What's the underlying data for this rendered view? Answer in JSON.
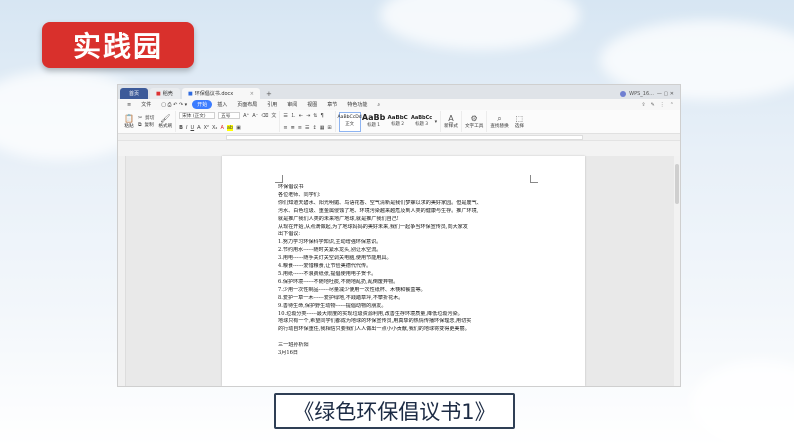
{
  "banner": {
    "title": "实践园"
  },
  "caption": "《绿色环保倡议书1》",
  "window": {
    "tabs": [
      {
        "label": "首页",
        "kind": "home"
      },
      {
        "label": "稻壳",
        "kind": "plain"
      },
      {
        "label": "环保倡议书.docx",
        "kind": "file"
      }
    ],
    "new_tab": "+",
    "user": "WPS_16..."
  },
  "menu": {
    "file": "文件",
    "items": [
      "开始",
      "插入",
      "页面布局",
      "引用",
      "审阅",
      "视图",
      "章节",
      "特色功能"
    ],
    "active": "开始"
  },
  "ribbon": {
    "paste": "粘贴",
    "cut": "剪切",
    "copy": "复制",
    "format_painter": "格式刷",
    "font_name": "宋体 (正文)",
    "font_size": "五号",
    "styles": [
      {
        "preview": "AaBbCcDd",
        "label": "正文",
        "level": "normal",
        "selected": true
      },
      {
        "preview": "AaBb",
        "label": "标题 1",
        "level": "h1",
        "selected": false
      },
      {
        "preview": "AaBbC",
        "label": "标题 2",
        "level": "h2",
        "selected": false
      },
      {
        "preview": "AaBbCc",
        "label": "标题 3",
        "level": "h3",
        "selected": false
      }
    ],
    "new_style": "新样式",
    "text_tools": "文字工具",
    "find_replace": "查找替换",
    "select": "选择"
  },
  "document": {
    "lines": [
      "环保倡议书",
      "各位老师、同学们:",
      "你们知道天碧水、阳光明媚、鸟语花香、空气清新是我们梦寐以求的美好家园。但是废气、",
      "污水、白色垃圾、重金属侵蚀了地、环境污染越来越危及到人类的健康与生存。推广环境,",
      "就是推广我们人类的未来地广地球,就是推广我们自己!",
      "从现在开始,从点滴做起,为了地球妈妈的美好未来,我们一起争当环保宣传员,向大家发",
      "出下倡议:",
      "1.努力学习环保科学知识,主动增强环保意识。",
      "2.节约用水------随时关紧水龙头,别让水空流。",
      "3.用电------随手关灯关空调关电脑,使用节能用具。",
      "4.粮食------爱惜粮食,让节俭美德代代传。",
      "5.用纸------不浪费纸张,提倡使用电子贺卡。",
      "6.保护环境------不随地吐痰,不随地乱扔,乱倒废弃物。",
      "7.少用一次性制品------尽量减少使用一次性纸杯、木筷和餐盒等。",
      "8.爱护一草一木------爱护绿地,不践踏草坪,不攀折花木。",
      "9.善待生命,保护野生动物------提倡动物的朋友。",
      "10.垃圾分类------最大限度的实现垃圾资源利用,改善生存环境质量,降低垃圾污染。",
      "地球只有一个,希望同学们都成为地球的环保宣传员,用真挚的热情传播环保理念,用切实",
      "的行动自环保重任,我相信只要我们人人做出一点小小贡献,我们的地球将变得更美丽。",
      "",
      "三一班孙析阳",
      "3月16日"
    ]
  }
}
